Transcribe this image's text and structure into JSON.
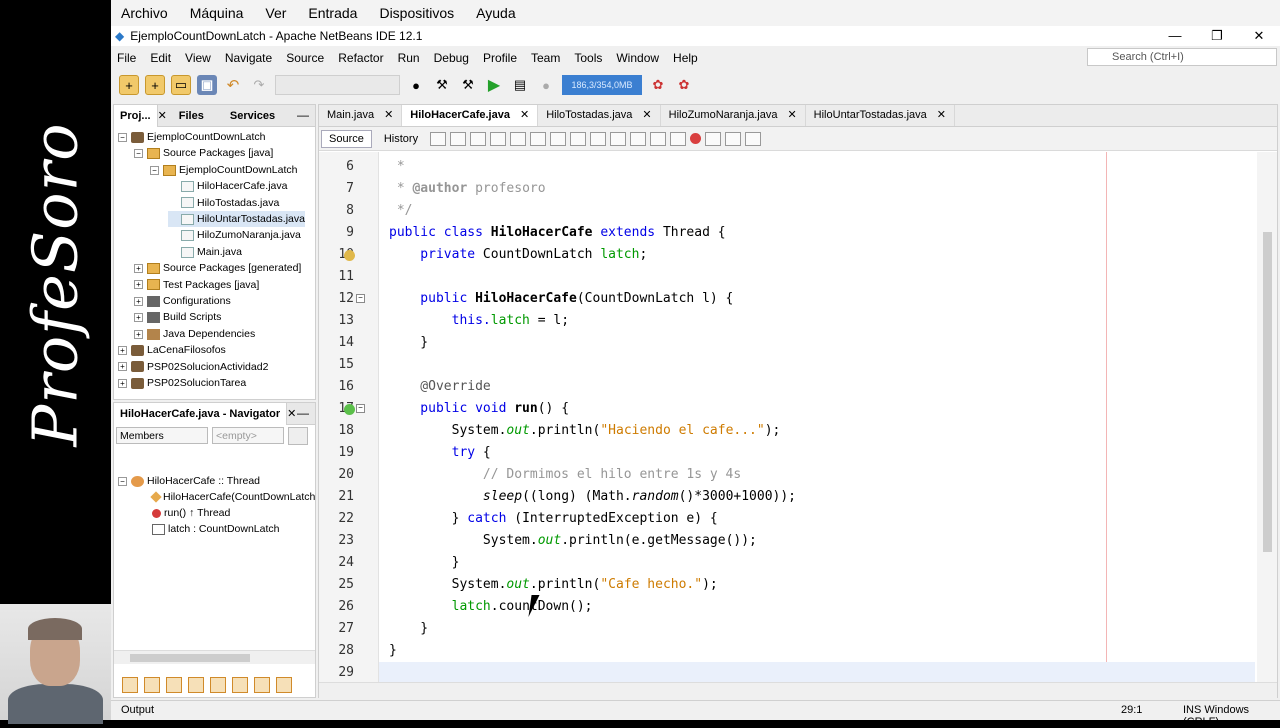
{
  "brand": "ProfeSoro",
  "vbox_menu": [
    "Archivo",
    "Máquina",
    "Ver",
    "Entrada",
    "Dispositivos",
    "Ayuda"
  ],
  "window": {
    "title": "EjemploCountDownLatch - Apache NetBeans IDE 12.1",
    "minimize": "—",
    "restore": "❐",
    "close": "✕"
  },
  "menu": [
    "File",
    "Edit",
    "View",
    "Navigate",
    "Source",
    "Refactor",
    "Run",
    "Debug",
    "Profile",
    "Team",
    "Tools",
    "Window",
    "Help"
  ],
  "search_placeholder": "Search (Ctrl+I)",
  "memory": "186,3/354,0MB",
  "project_tabs": [
    "Proj...",
    "Files",
    "Services"
  ],
  "project_tree": [
    {
      "label": "EjemploCountDownLatch",
      "icon": "project-icon",
      "toggle": "−"
    },
    {
      "label": "Source Packages [java]",
      "icon": "package-icon",
      "toggle": "−"
    },
    {
      "label": "EjemploCountDownLatch",
      "icon": "package-icon",
      "toggle": "−"
    },
    {
      "label": "HiloHacerCafe.java",
      "icon": "java-file-icon",
      "toggle": ""
    },
    {
      "label": "HiloTostadas.java",
      "icon": "java-file-icon",
      "toggle": ""
    },
    {
      "label": "HiloUntarTostadas.java",
      "icon": "java-file-icon",
      "toggle": ""
    },
    {
      "label": "HiloZumoNaranja.java",
      "icon": "java-file-icon",
      "toggle": ""
    },
    {
      "label": "Main.java",
      "icon": "java-file-icon",
      "toggle": ""
    },
    {
      "label": "Source Packages [generated]",
      "icon": "package-icon",
      "toggle": "+"
    },
    {
      "label": "Test Packages [java]",
      "icon": "package-icon",
      "toggle": "+"
    },
    {
      "label": "Configurations",
      "icon": "config-icon",
      "toggle": "+"
    },
    {
      "label": "Build Scripts",
      "icon": "config-icon",
      "toggle": "+"
    },
    {
      "label": "Java Dependencies",
      "icon": "library-icon",
      "toggle": "+"
    },
    {
      "label": "LaCenaFilosofos",
      "icon": "project-icon",
      "toggle": "+"
    },
    {
      "label": "PSP02SolucionActividad2",
      "icon": "project-icon",
      "toggle": "+"
    },
    {
      "label": "PSP02SolucionTarea",
      "icon": "project-icon",
      "toggle": "+"
    }
  ],
  "navigator": {
    "title": "HiloHacerCafe.java - Navigator",
    "members": "Members",
    "filter": "<empty>",
    "items": [
      "HiloHacerCafe :: Thread",
      "HiloHacerCafe(CountDownLatch",
      "run() ↑ Thread",
      "latch : CountDownLatch"
    ]
  },
  "editor_tabs": [
    "Main.java",
    "HiloHacerCafe.java",
    "HiloTostadas.java",
    "HiloZumoNaranja.java",
    "HiloUntarTostadas.java"
  ],
  "editor_toolbar": {
    "source": "Source",
    "history": "History"
  },
  "line_numbers": [
    "6",
    "7",
    "8",
    "9",
    "10",
    "11",
    "12",
    "13",
    "14",
    "15",
    "16",
    "17",
    "18",
    "19",
    "20",
    "21",
    "22",
    "23",
    "24",
    "25",
    "26",
    "27",
    "28",
    "29"
  ],
  "code": {
    "l6": " *",
    "l7a": " * ",
    "l7b": "@author",
    "l7c": " profesoro",
    "l8": " */",
    "l9a": "public class ",
    "l9b": "HiloHacerCafe",
    "l9c": " extends ",
    "l9d": "Thread {",
    "l10a": "    private ",
    "l10b": "CountDownLatch ",
    "l10c": "latch",
    ";": ";",
    "l12a": "    public ",
    "l12b": "HiloHacerCafe",
    "l12c": "(CountDownLatch l) {",
    "l13a": "        this.",
    "l13b": "latch",
    " l13c": " = l;",
    "l14": "    }",
    "l16": "    @Override",
    "l17a": "    public void ",
    "l17b": "run",
    "l17c": "() {",
    "l18a": "        System.",
    "l18b": "out",
    "l18c": ".println(",
    "l18d": "\"Haciendo el cafe...\"",
    "l18e": ");",
    "l19a": "        try",
    "l19b": " {",
    "l20": "            // Dormimos el hilo entre 1s y 4s",
    "l21a": "            ",
    "l21b": "sleep",
    "l21c": "((long) (Math.",
    "l21d": "random",
    "l21e": "()*3000+1000));",
    "l22a": "        } ",
    "l22b": "catch",
    "l22c": " (InterruptedException e) {",
    "l23a": "            System.",
    "l23b": "out",
    "l23c": ".println(e.getMessage());",
    "l24": "        }",
    "l25a": "        System.",
    "l25b": "out",
    "l25c": ".println(",
    "l25d": "\"Cafe hecho.\"",
    "l25e": ");",
    "l26a": "        ",
    "l26b": "latch",
    "l26c": ".countDown();",
    "l27": "    }",
    "l28": "}"
  },
  "status": {
    "output": "Output",
    "position": "29:1",
    "insert": "INS Windows (CRLF)"
  }
}
